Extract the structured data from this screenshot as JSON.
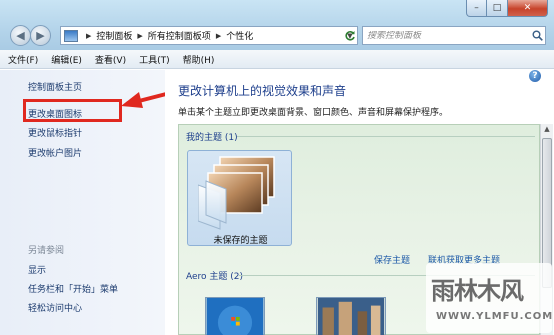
{
  "window": {
    "title_buttons": {
      "min": "–",
      "max": "□",
      "close": "✕"
    }
  },
  "nav": {
    "back": "◀",
    "forward": "▶"
  },
  "address": {
    "crumbs": [
      "控制面板",
      "所有控制面板项",
      "个性化"
    ]
  },
  "search": {
    "placeholder": "搜索控制面板"
  },
  "menu": [
    "文件(F)",
    "编辑(E)",
    "查看(V)",
    "工具(T)",
    "帮助(H)"
  ],
  "sidebar": {
    "home": "控制面板主页",
    "links": [
      "更改桌面图标",
      "更改鼠标指针",
      "更改帐户图片"
    ],
    "see_also": "另请参阅",
    "see_also_links": [
      "显示",
      "任务栏和「开始」菜单",
      "轻松访问中心"
    ]
  },
  "main": {
    "heading": "更改计算机上的视觉效果和声音",
    "subtitle": "单击某个主题立即更改桌面背景、窗口颜色、声音和屏幕保护程序。",
    "my_themes_label": "我的主题 (1)",
    "unsaved_theme": "未保存的主题",
    "save_theme": "保存主题",
    "get_more": "联机获取更多主题",
    "aero_label": "Aero 主题 (2)"
  },
  "watermark": {
    "title": "雨林木风",
    "url": "WWW.YLMFU.COM"
  },
  "colors": {
    "annotation_red": "#e0281f",
    "link_blue": "#1e5aa8",
    "heading_blue": "#1e3f8c"
  }
}
